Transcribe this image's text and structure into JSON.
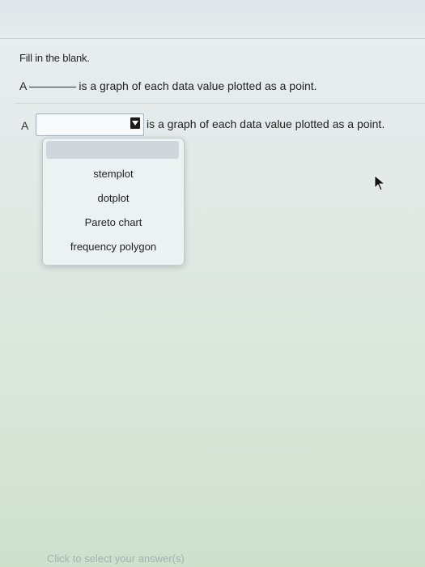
{
  "question": {
    "instruction": "Fill in the blank.",
    "prompt_letter": "A",
    "prompt_text": "is a graph of each data value plotted as a point.",
    "answer_letter": "A",
    "answer_text": "is a graph of each data value plotted as a point."
  },
  "dropdown": {
    "selected": "",
    "options": [
      "stemplot",
      "dotplot",
      "Pareto chart",
      "frequency polygon"
    ]
  },
  "footer": {
    "hint": "Click to select your answer(s)"
  },
  "icons": {
    "select_arrow": "chevron-down-icon",
    "cursor": "mouse-pointer-icon"
  }
}
